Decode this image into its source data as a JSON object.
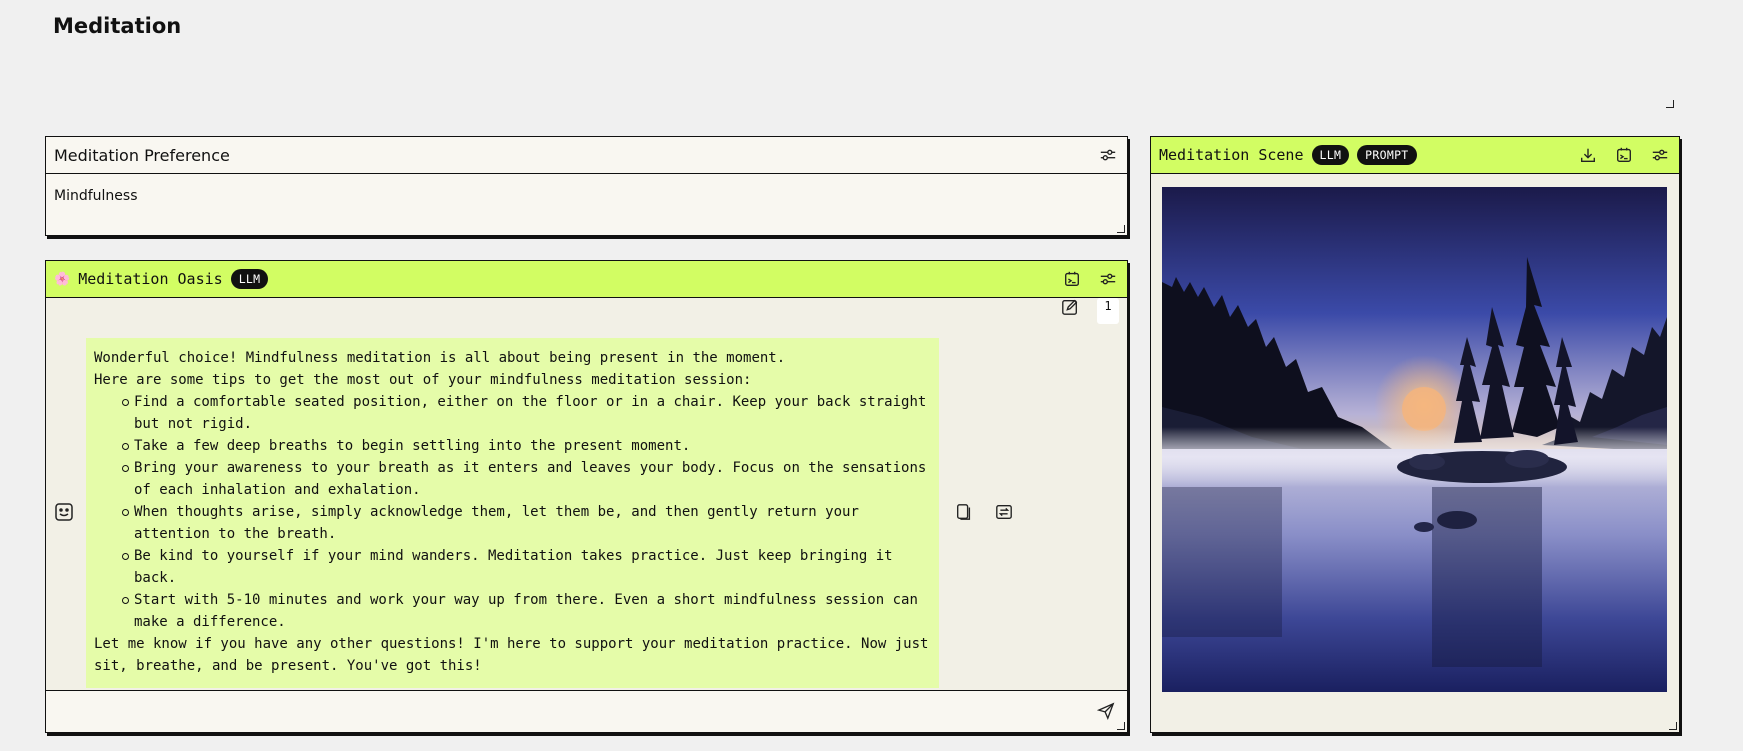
{
  "page": {
    "title": "Meditation"
  },
  "preference": {
    "title": "Meditation Preference",
    "value": "Mindfulness"
  },
  "oasis": {
    "emoji": "🌸",
    "title": "Meditation Oasis",
    "tag": "LLM",
    "message_count": "1",
    "message": {
      "intro": "Wonderful choice! Mindfulness meditation is all about being present in the moment.",
      "lead": "Here are some tips to get the most out of your mindfulness meditation session:",
      "tips": [
        "Find a comfortable seated position, either on the floor or in a chair. Keep your back straight but not rigid.",
        "Take a few deep breaths to begin settling into the present moment.",
        "Bring your awareness to your breath as it enters and leaves your body. Focus on the sensations of each inhalation and exhalation.",
        "When thoughts arise, simply acknowledge them, let them be, and then gently return your attention to the breath.",
        "Be kind to yourself if your mind wanders. Meditation takes practice. Just keep bringing it back.",
        "Start with 5-10 minutes and work your way up from there. Even a short mindfulness session can make a difference."
      ],
      "outro": "Let me know if you have any other questions! I'm here to support your meditation practice. Now just sit, breathe, and be present. You've got this!"
    },
    "input": {
      "value": "",
      "placeholder": ""
    }
  },
  "scene": {
    "title": "Meditation Scene",
    "tags": [
      "LLM",
      "PROMPT"
    ]
  },
  "icons": {
    "settings": "sliders-icon",
    "export": "export-icon",
    "download": "download-icon",
    "copy": "copy-icon",
    "regenerate": "regenerate-icon",
    "edit": "pencil-icon",
    "send": "send-icon",
    "avatar": "robot-face-icon"
  },
  "colors": {
    "accent": "#d2fd63",
    "message_bg": "#e5fca9",
    "panel_bg": "#f9f7f1",
    "body_bg": "#f2f0e6"
  }
}
